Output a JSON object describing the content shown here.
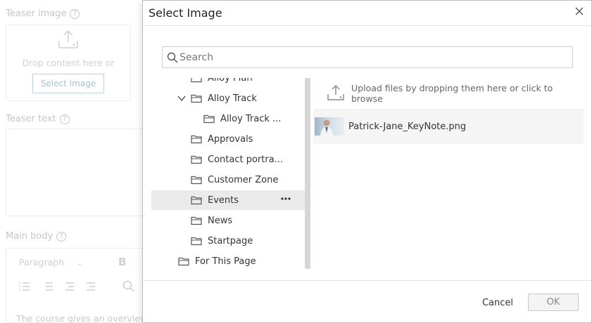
{
  "background": {
    "teaser_image_label": "Teaser image",
    "drop_text": "Drop content here or",
    "select_image_button": "Select Image",
    "teaser_text_label": "Teaser text",
    "main_body_label": "Main body",
    "paragraph_select": "Paragraph",
    "bold_label": "B",
    "body_text": "The course gives an overview"
  },
  "dialog": {
    "title": "Select Image",
    "search_placeholder": "Search",
    "tree": [
      {
        "label": "Alloy Plan",
        "indent": 1,
        "expanded": false,
        "selected": false
      },
      {
        "label": "Alloy Track",
        "indent": 1,
        "expanded": true,
        "selected": false
      },
      {
        "label": "Alloy Track ...",
        "indent": 2,
        "expanded": false,
        "selected": false
      },
      {
        "label": "Approvals",
        "indent": 1,
        "expanded": false,
        "selected": false
      },
      {
        "label": "Contact portra...",
        "indent": 1,
        "expanded": false,
        "selected": false
      },
      {
        "label": "Customer Zone",
        "indent": 1,
        "expanded": false,
        "selected": false
      },
      {
        "label": "Events",
        "indent": 1,
        "expanded": false,
        "selected": true
      },
      {
        "label": "News",
        "indent": 1,
        "expanded": false,
        "selected": false
      },
      {
        "label": "Startpage",
        "indent": 1,
        "expanded": false,
        "selected": false
      },
      {
        "label": "For This Page",
        "indent": 0,
        "expanded": false,
        "selected": false
      }
    ],
    "upload_text": "Upload files by dropping them here or click to browse",
    "files": [
      {
        "name": "Patrick-Jane_KeyNote.png"
      }
    ],
    "cancel_label": "Cancel",
    "ok_label": "OK"
  }
}
